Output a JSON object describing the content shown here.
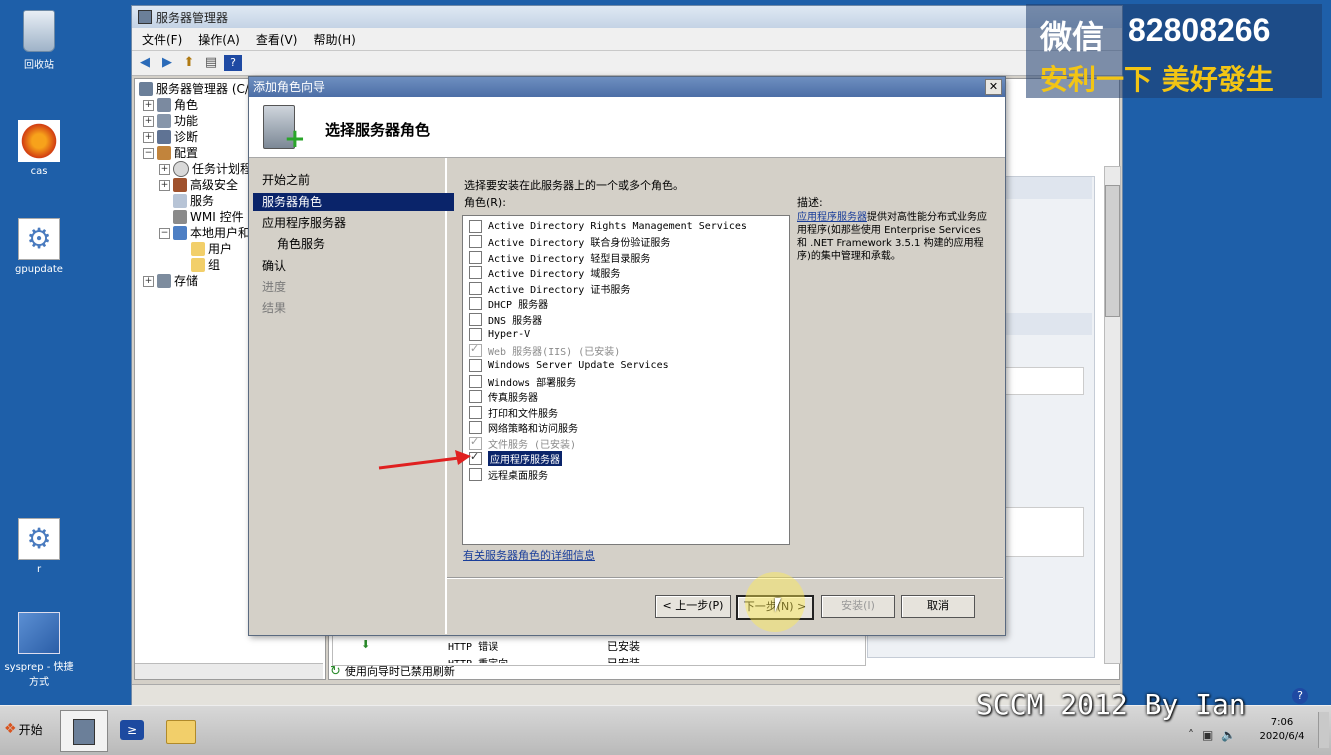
{
  "desktop": {
    "icons": [
      {
        "label": "回收站"
      },
      {
        "label": "cas"
      },
      {
        "label": "gpupdate"
      },
      {
        "label": "r"
      },
      {
        "label": "sysprep - 快捷方式"
      }
    ]
  },
  "server_manager": {
    "title": "服务器管理器",
    "menu": [
      "文件(F)",
      "操作(A)",
      "查看(V)",
      "帮助(H)"
    ],
    "tree": {
      "root": "服务器管理器 (C/",
      "items": [
        "角色",
        "功能",
        "诊断",
        "配置",
        "任务计划程",
        "高级安全",
        "服务",
        "WMI 控件",
        "本地用户和",
        "用户",
        "组",
        "存储"
      ]
    },
    "status_text": "使用向导时已禁用刷新",
    "bottom_list": [
      {
        "name": "HTTP 错误",
        "status": "已安装"
      },
      {
        "name": "HTTP 重定向",
        "status": "已安装"
      }
    ],
    "right_panel_fragments": [
      "助",
      "S)"
    ]
  },
  "wizard": {
    "title": "添加角色向导",
    "close_label": "✕",
    "header_title": "选择服务器角色",
    "steps": [
      {
        "label": "开始之前",
        "state": "normal"
      },
      {
        "label": "服务器角色",
        "state": "selected"
      },
      {
        "label": "应用程序服务器",
        "state": "normal"
      },
      {
        "label": "角色服务",
        "state": "normal"
      },
      {
        "label": "确认",
        "state": "normal"
      },
      {
        "label": "进度",
        "state": "disabled"
      },
      {
        "label": "结果",
        "state": "disabled"
      }
    ],
    "instruction": "选择要安装在此服务器上的一个或多个角色。",
    "roles_label": "角色(R):",
    "roles": [
      {
        "label": "Active Directory Rights Management Services",
        "checked": false,
        "disabled": false
      },
      {
        "label": "Active Directory 联合身份验证服务",
        "checked": false,
        "disabled": false
      },
      {
        "label": "Active Directory 轻型目录服务",
        "checked": false,
        "disabled": false
      },
      {
        "label": "Active Directory 域服务",
        "checked": false,
        "disabled": false
      },
      {
        "label": "Active Directory 证书服务",
        "checked": false,
        "disabled": false
      },
      {
        "label": "DHCP 服务器",
        "checked": false,
        "disabled": false
      },
      {
        "label": "DNS 服务器",
        "checked": false,
        "disabled": false
      },
      {
        "label": "Hyper-V",
        "checked": false,
        "disabled": false
      },
      {
        "label": "Web 服务器(IIS)  (已安装)",
        "checked": true,
        "disabled": true
      },
      {
        "label": "Windows Server Update Services",
        "checked": false,
        "disabled": false
      },
      {
        "label": "Windows 部署服务",
        "checked": false,
        "disabled": false
      },
      {
        "label": "传真服务器",
        "checked": false,
        "disabled": false
      },
      {
        "label": "打印和文件服务",
        "checked": false,
        "disabled": false
      },
      {
        "label": "网络策略和访问服务",
        "checked": false,
        "disabled": false
      },
      {
        "label": "文件服务  (已安装)",
        "checked": true,
        "disabled": true
      },
      {
        "label": "应用程序服务器",
        "checked": true,
        "disabled": false,
        "highlighted": true
      },
      {
        "label": "远程桌面服务",
        "checked": false,
        "disabled": false
      }
    ],
    "description_label": "描述:",
    "description_link": "应用程序服务器",
    "description_text": "提供对高性能分布式业务应用程序(如那些使用 Enterprise Services 和 .NET Framework 3.5.1 构建的应用程序)的集中管理和承载。",
    "more_info_link": "有关服务器角色的详细信息",
    "buttons": {
      "back": "< 上一步(P)",
      "next": "下一步(N) >",
      "install": "安装(I)",
      "cancel": "取消"
    }
  },
  "watermark": {
    "line1_prefix": "微信",
    "line1_number": "82808266",
    "line2": "安利一下 美好發生",
    "bottom_caption": "SCCM 2012 By Ian"
  },
  "taskbar": {
    "start_label": "开始",
    "clock_time": "7:06",
    "clock_date": "2020/6/4"
  }
}
